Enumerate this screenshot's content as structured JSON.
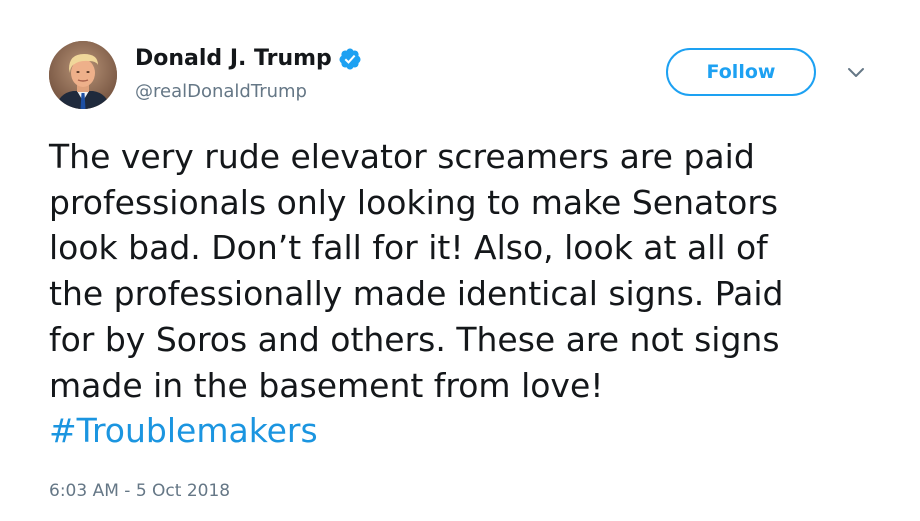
{
  "author": {
    "display_name": "Donald J. Trump",
    "handle": "@realDonaldTrump",
    "verified": true
  },
  "actions": {
    "follow_label": "Follow"
  },
  "tweet": {
    "lines": [
      "The very rude elevator screamers are paid",
      "professionals only looking to make Senators",
      "look bad. Don’t fall for it! Also, look at all of",
      "the professionally made identical signs. Paid",
      "for by Soros and others. These are not signs",
      "made in the basement from love!"
    ],
    "hashtag": "#Troublemakers",
    "timestamp": "6:03 AM - 5 Oct 2018"
  },
  "colors": {
    "accent": "#1da1f2",
    "link": "#1b95e0",
    "text": "#14171a",
    "secondary_text": "#657786"
  },
  "icons": {
    "verified": "verified-badge-icon",
    "more": "chevron-down-icon"
  }
}
